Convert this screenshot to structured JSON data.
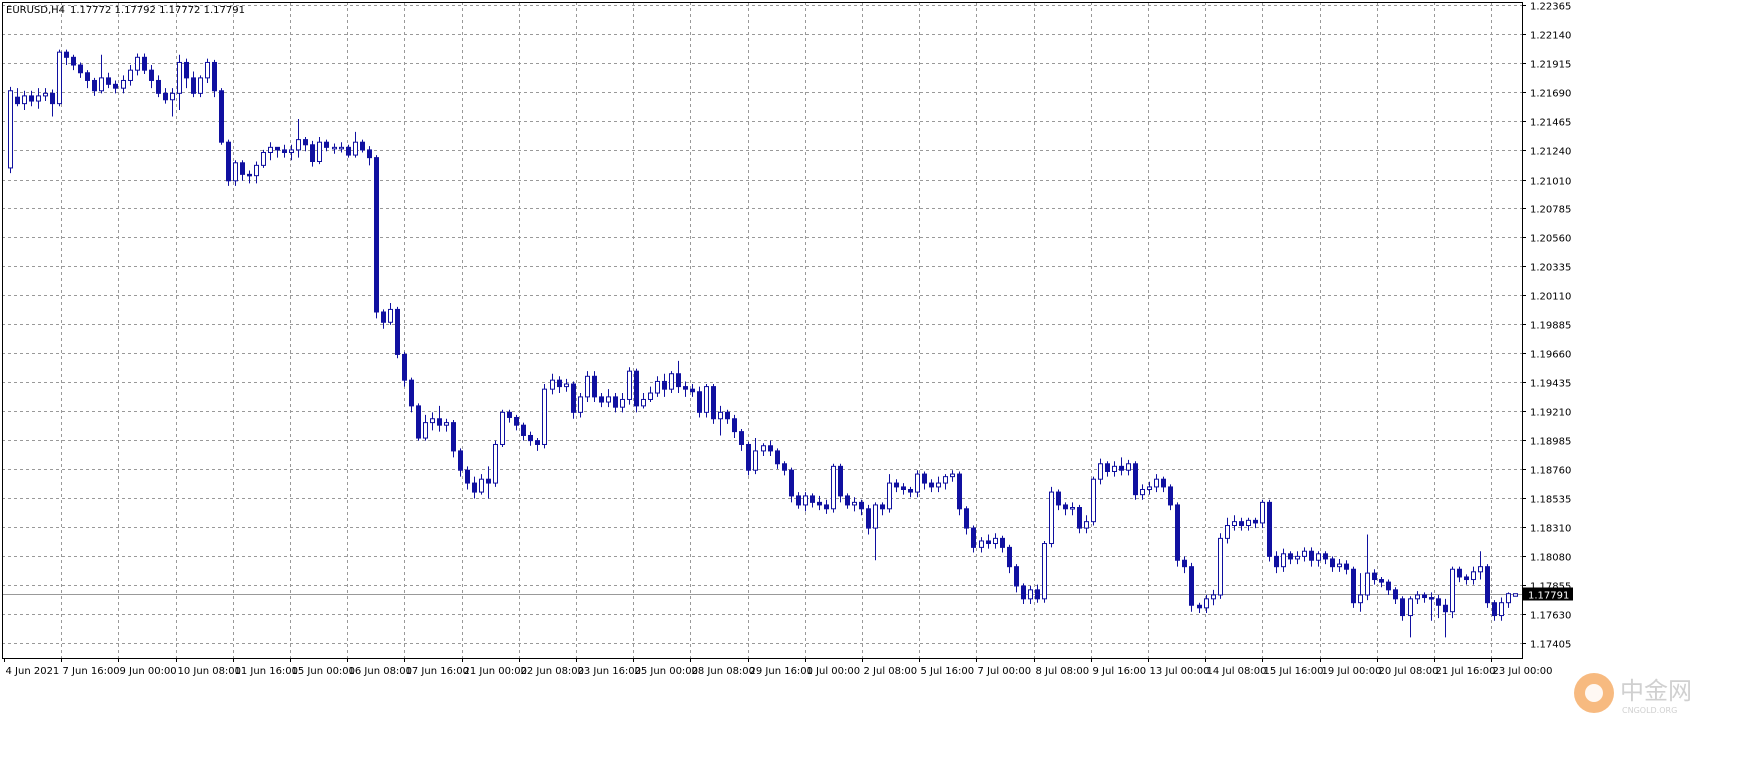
{
  "header": {
    "symbol_text": "EURUSD,H4",
    "ohlc_text": "1.17772 1.17792 1.17772 1.17791"
  },
  "price_label": "1.17791",
  "watermark": {
    "text": "中金网",
    "sub": "CNGOLD.ORG"
  },
  "colors": {
    "candle": "#1010a0",
    "grid": "#999999",
    "axis": "#000000",
    "last_price_line": "#999999"
  },
  "chart_data": {
    "type": "candlestick",
    "symbol": "EURUSD",
    "timeframe": "H4",
    "ylim": [
      1.1729,
      1.2239
    ],
    "y_ticks": [
      "1.22365",
      "1.22140",
      "1.21915",
      "1.21690",
      "1.21465",
      "1.21240",
      "1.21010",
      "1.20785",
      "1.20560",
      "1.20335",
      "1.20110",
      "1.19885",
      "1.19660",
      "1.19435",
      "1.19210",
      "1.18985",
      "1.18760",
      "1.18535",
      "1.18310",
      "1.18080",
      "1.17855",
      "1.17630",
      "1.17405"
    ],
    "x_labels": [
      "4 Jun 2021",
      "7 Jun 16:00",
      "9 Jun 00:00",
      "10 Jun 08:00",
      "11 Jun 16:00",
      "15 Jun 00:00",
      "16 Jun 08:00",
      "17 Jun 16:00",
      "21 Jun 00:00",
      "22 Jun 08:00",
      "23 Jun 16:00",
      "25 Jun 00:00",
      "28 Jun 08:00",
      "29 Jun 16:00",
      "1 Jul 00:00",
      "2 Jul 08:00",
      "5 Jul 16:00",
      "7 Jul 00:00",
      "8 Jul 08:00",
      "9 Jul 16:00",
      "13 Jul 00:00",
      "14 Jul 08:00",
      "15 Jul 16:00",
      "19 Jul 00:00",
      "20 Jul 08:00",
      "21 Jul 16:00",
      "23 Jul 00:00"
    ],
    "last_price": 1.17791,
    "candles": [
      [
        1.211,
        1.217,
        1.2106,
        1.2173
      ],
      [
        1.2165,
        1.216,
        1.2158,
        1.2172
      ],
      [
        1.216,
        1.2166,
        1.2155,
        1.217
      ],
      [
        1.2166,
        1.2162,
        1.2158,
        1.217
      ],
      [
        1.2162,
        1.2166,
        1.2156,
        1.2172
      ],
      [
        1.2166,
        1.2168,
        1.2162,
        1.2172
      ],
      [
        1.2168,
        1.216,
        1.215,
        1.2171
      ],
      [
        1.216,
        1.22,
        1.2158,
        1.2202
      ],
      [
        1.22,
        1.2196,
        1.219,
        1.2202
      ],
      [
        1.2196,
        1.219,
        1.2186,
        1.2198
      ],
      [
        1.219,
        1.2184,
        1.218,
        1.2192
      ],
      [
        1.2184,
        1.2178,
        1.2172,
        1.2186
      ],
      [
        1.2178,
        1.217,
        1.2166,
        1.218
      ],
      [
        1.217,
        1.218,
        1.2168,
        1.2198
      ],
      [
        1.218,
        1.2175,
        1.2172,
        1.2184
      ],
      [
        1.2175,
        1.2172,
        1.2168,
        1.2178
      ],
      [
        1.2172,
        1.2178,
        1.2168,
        1.2182
      ],
      [
        1.2178,
        1.2186,
        1.2174,
        1.219
      ],
      [
        1.2186,
        1.2196,
        1.2182,
        1.2199
      ],
      [
        1.2196,
        1.2186,
        1.2183,
        1.2199
      ],
      [
        1.2186,
        1.2178,
        1.2172,
        1.219
      ],
      [
        1.2178,
        1.2168,
        1.2165,
        1.2182
      ],
      [
        1.2168,
        1.2163,
        1.216,
        1.2172
      ],
      [
        1.2163,
        1.2168,
        1.215,
        1.2172
      ],
      [
        1.2168,
        1.2192,
        1.2155,
        1.2198
      ],
      [
        1.2192,
        1.218,
        1.2172,
        1.2195
      ],
      [
        1.218,
        1.2168,
        1.2165,
        1.2185
      ],
      [
        1.2168,
        1.218,
        1.2165,
        1.2182
      ],
      [
        1.218,
        1.2192,
        1.2176,
        1.2195
      ],
      [
        1.2192,
        1.217,
        1.2165,
        1.2194
      ],
      [
        1.217,
        1.213,
        1.2128,
        1.2172
      ],
      [
        1.213,
        1.21,
        1.2096,
        1.2132
      ],
      [
        1.21,
        1.2114,
        1.2096,
        1.2116
      ],
      [
        1.2114,
        1.2105,
        1.21,
        1.2116
      ],
      [
        1.2105,
        1.2104,
        1.2098,
        1.2108
      ],
      [
        1.2104,
        1.2112,
        1.2098,
        1.2115
      ],
      [
        1.2112,
        1.2122,
        1.211,
        1.2124
      ],
      [
        1.2122,
        1.2126,
        1.2116,
        1.213
      ],
      [
        1.2126,
        1.2124,
        1.2118,
        1.2126
      ],
      [
        1.2124,
        1.2122,
        1.2118,
        1.2128
      ],
      [
        1.2122,
        1.2124,
        1.2116,
        1.2128
      ],
      [
        1.2124,
        1.2132,
        1.2118,
        1.2148
      ],
      [
        1.2132,
        1.2128,
        1.2123,
        1.2134
      ],
      [
        1.2128,
        1.2115,
        1.2111,
        1.2131
      ],
      [
        1.2115,
        1.213,
        1.2113,
        1.2134
      ],
      [
        1.213,
        1.2126,
        1.2123,
        1.2132
      ],
      [
        1.2126,
        1.2126,
        1.2121,
        1.2129
      ],
      [
        1.2126,
        1.2126,
        1.2122,
        1.213
      ],
      [
        1.2126,
        1.212,
        1.2118,
        1.2128
      ],
      [
        1.212,
        1.213,
        1.2118,
        1.2138
      ],
      [
        1.213,
        1.2124,
        1.2122,
        1.2132
      ],
      [
        1.2124,
        1.2118,
        1.2112,
        1.2127
      ],
      [
        1.2118,
        1.1998,
        1.1993,
        1.212
      ],
      [
        1.1998,
        1.199,
        1.1985,
        1.2
      ],
      [
        1.199,
        1.2,
        1.1988,
        1.2005
      ],
      [
        1.2,
        1.1965,
        1.1962,
        1.2002
      ],
      [
        1.1965,
        1.1945,
        1.194,
        1.1967
      ],
      [
        1.1945,
        1.1925,
        1.192,
        1.1947
      ],
      [
        1.1925,
        1.19,
        1.1898,
        1.1927
      ],
      [
        1.19,
        1.1912,
        1.1898,
        1.1918
      ],
      [
        1.1912,
        1.1915,
        1.1906,
        1.192
      ],
      [
        1.1915,
        1.191,
        1.1905,
        1.1925
      ],
      [
        1.191,
        1.1912,
        1.1905,
        1.1915
      ],
      [
        1.1912,
        1.189,
        1.1885,
        1.1914
      ],
      [
        1.189,
        1.1875,
        1.187,
        1.1892
      ],
      [
        1.1875,
        1.1865,
        1.186,
        1.1878
      ],
      [
        1.1865,
        1.1858,
        1.1853,
        1.187
      ],
      [
        1.1858,
        1.1868,
        1.1856,
        1.1872
      ],
      [
        1.1868,
        1.1865,
        1.1853,
        1.1878
      ],
      [
        1.1865,
        1.1895,
        1.1862,
        1.1898
      ],
      [
        1.1895,
        1.192,
        1.1893,
        1.1922
      ],
      [
        1.192,
        1.1916,
        1.1912,
        1.1922
      ],
      [
        1.1916,
        1.191,
        1.1906,
        1.1918
      ],
      [
        1.191,
        1.1902,
        1.1898,
        1.1912
      ],
      [
        1.1902,
        1.1898,
        1.1894,
        1.1905
      ],
      [
        1.1898,
        1.1895,
        1.189,
        1.19
      ],
      [
        1.1895,
        1.1938,
        1.1892,
        1.1942
      ],
      [
        1.1938,
        1.1945,
        1.1934,
        1.195
      ],
      [
        1.1945,
        1.194,
        1.1935,
        1.1948
      ],
      [
        1.194,
        1.1942,
        1.1936,
        1.1946
      ],
      [
        1.1942,
        1.192,
        1.1915,
        1.1944
      ],
      [
        1.192,
        1.1932,
        1.1916,
        1.1935
      ],
      [
        1.1932,
        1.1948,
        1.1928,
        1.1952
      ],
      [
        1.1948,
        1.1932,
        1.1928,
        1.1952
      ],
      [
        1.1932,
        1.1928,
        1.1924,
        1.1935
      ],
      [
        1.1928,
        1.1932,
        1.1924,
        1.1938
      ],
      [
        1.1932,
        1.1924,
        1.192,
        1.1935
      ],
      [
        1.1924,
        1.193,
        1.192,
        1.1935
      ],
      [
        1.193,
        1.1952,
        1.1926,
        1.1955
      ],
      [
        1.1952,
        1.1925,
        1.192,
        1.1954
      ],
      [
        1.1925,
        1.193,
        1.1923,
        1.1935
      ],
      [
        1.193,
        1.1935,
        1.1928,
        1.194
      ],
      [
        1.1935,
        1.1944,
        1.1932,
        1.1948
      ],
      [
        1.1944,
        1.1938,
        1.1932,
        1.195
      ],
      [
        1.1938,
        1.195,
        1.1935,
        1.1952
      ],
      [
        1.195,
        1.194,
        1.1935,
        1.196
      ],
      [
        1.194,
        1.1938,
        1.1932,
        1.1944
      ],
      [
        1.1938,
        1.1936,
        1.1932,
        1.1942
      ],
      [
        1.1936,
        1.192,
        1.1916,
        1.194
      ],
      [
        1.192,
        1.194,
        1.1916,
        1.1942
      ],
      [
        1.194,
        1.1915,
        1.1911,
        1.1942
      ],
      [
        1.1915,
        1.192,
        1.1902,
        1.1925
      ],
      [
        1.192,
        1.1915,
        1.1911,
        1.1922
      ],
      [
        1.1915,
        1.1905,
        1.19,
        1.1918
      ],
      [
        1.1905,
        1.1895,
        1.189,
        1.1907
      ],
      [
        1.1895,
        1.1875,
        1.1871,
        1.1897
      ],
      [
        1.1875,
        1.189,
        1.1872,
        1.19
      ],
      [
        1.189,
        1.1894,
        1.1886,
        1.1896
      ],
      [
        1.1894,
        1.189,
        1.1886,
        1.1898
      ],
      [
        1.189,
        1.188,
        1.1876,
        1.1892
      ],
      [
        1.188,
        1.1875,
        1.1871,
        1.1882
      ],
      [
        1.1875,
        1.1855,
        1.185,
        1.1877
      ],
      [
        1.1855,
        1.1848,
        1.1845,
        1.1858
      ],
      [
        1.1848,
        1.1855,
        1.1843,
        1.1858
      ],
      [
        1.1855,
        1.185,
        1.1846,
        1.1857
      ],
      [
        1.185,
        1.1848,
        1.1844,
        1.1855
      ],
      [
        1.1848,
        1.1845,
        1.1841,
        1.1852
      ],
      [
        1.1845,
        1.1878,
        1.1842,
        1.188
      ],
      [
        1.1878,
        1.1855,
        1.185,
        1.188
      ],
      [
        1.1855,
        1.1848,
        1.1845,
        1.1857
      ],
      [
        1.1848,
        1.185,
        1.1843,
        1.1854
      ],
      [
        1.185,
        1.1845,
        1.184,
        1.1852
      ],
      [
        1.1845,
        1.183,
        1.1825,
        1.1848
      ],
      [
        1.183,
        1.1848,
        1.1805,
        1.185
      ],
      [
        1.1848,
        1.1845,
        1.184,
        1.185
      ],
      [
        1.1845,
        1.1865,
        1.1842,
        1.1872
      ],
      [
        1.1865,
        1.1862,
        1.1858,
        1.1868
      ],
      [
        1.1862,
        1.186,
        1.1856,
        1.1865
      ],
      [
        1.186,
        1.1858,
        1.1854,
        1.1862
      ],
      [
        1.1858,
        1.1872,
        1.1854,
        1.1875
      ],
      [
        1.1872,
        1.1865,
        1.186,
        1.1874
      ],
      [
        1.1865,
        1.1862,
        1.1858,
        1.1868
      ],
      [
        1.1862,
        1.1865,
        1.1858,
        1.187
      ],
      [
        1.1865,
        1.187,
        1.186,
        1.1872
      ],
      [
        1.187,
        1.1872,
        1.1866,
        1.1875
      ],
      [
        1.1872,
        1.1845,
        1.184,
        1.1874
      ],
      [
        1.1845,
        1.183,
        1.1825,
        1.1847
      ],
      [
        1.183,
        1.1815,
        1.1811,
        1.1832
      ],
      [
        1.1815,
        1.182,
        1.1811,
        1.1823
      ],
      [
        1.182,
        1.1818,
        1.1814,
        1.1825
      ],
      [
        1.1818,
        1.1822,
        1.1814,
        1.1826
      ],
      [
        1.1822,
        1.1815,
        1.1811,
        1.1824
      ],
      [
        1.1815,
        1.18,
        1.1795,
        1.1817
      ],
      [
        1.18,
        1.1785,
        1.178,
        1.1802
      ],
      [
        1.1785,
        1.1775,
        1.1771,
        1.1787
      ],
      [
        1.1775,
        1.1782,
        1.1771,
        1.1785
      ],
      [
        1.1782,
        1.1775,
        1.1772,
        1.1786
      ],
      [
        1.1775,
        1.1818,
        1.1772,
        1.182
      ],
      [
        1.1818,
        1.1858,
        1.1815,
        1.1862
      ],
      [
        1.1858,
        1.1848,
        1.1844,
        1.186
      ],
      [
        1.1848,
        1.1845,
        1.184,
        1.185
      ],
      [
        1.1845,
        1.1846,
        1.184,
        1.185
      ],
      [
        1.1846,
        1.183,
        1.1826,
        1.1848
      ],
      [
        1.183,
        1.1835,
        1.1826,
        1.184
      ],
      [
        1.1835,
        1.1868,
        1.1832,
        1.187
      ],
      [
        1.1868,
        1.188,
        1.1864,
        1.1884
      ],
      [
        1.188,
        1.1874,
        1.187,
        1.1882
      ],
      [
        1.1874,
        1.1878,
        1.187,
        1.1882
      ],
      [
        1.1878,
        1.1875,
        1.1871,
        1.1885
      ],
      [
        1.1875,
        1.188,
        1.1871,
        1.1883
      ],
      [
        1.188,
        1.1856,
        1.1852,
        1.1882
      ],
      [
        1.1856,
        1.186,
        1.1852,
        1.1864
      ],
      [
        1.186,
        1.1862,
        1.1856,
        1.1866
      ],
      [
        1.1862,
        1.1868,
        1.1858,
        1.1872
      ],
      [
        1.1868,
        1.1862,
        1.1858,
        1.187
      ],
      [
        1.1862,
        1.1848,
        1.1844,
        1.1864
      ],
      [
        1.1848,
        1.1805,
        1.18,
        1.185
      ],
      [
        1.1805,
        1.18,
        1.1795,
        1.1808
      ],
      [
        1.18,
        1.177,
        1.1765,
        1.1803
      ],
      [
        1.177,
        1.1768,
        1.1764,
        1.1772
      ],
      [
        1.1768,
        1.1775,
        1.1764,
        1.1778
      ],
      [
        1.1775,
        1.1778,
        1.177,
        1.1782
      ],
      [
        1.1778,
        1.1822,
        1.1775,
        1.1826
      ],
      [
        1.1822,
        1.1832,
        1.1818,
        1.1838
      ],
      [
        1.1832,
        1.1835,
        1.1828,
        1.184
      ],
      [
        1.1835,
        1.1832,
        1.1828,
        1.1838
      ],
      [
        1.1832,
        1.1836,
        1.1828,
        1.1838
      ],
      [
        1.1836,
        1.1834,
        1.183,
        1.1838
      ],
      [
        1.1834,
        1.185,
        1.183,
        1.1852
      ],
      [
        1.185,
        1.1808,
        1.1804,
        1.1852
      ],
      [
        1.1808,
        1.18,
        1.1795,
        1.1812
      ],
      [
        1.18,
        1.181,
        1.1796,
        1.1814
      ],
      [
        1.181,
        1.1806,
        1.1802,
        1.1812
      ],
      [
        1.1806,
        1.1808,
        1.1802,
        1.1812
      ],
      [
        1.1808,
        1.1812,
        1.1804,
        1.1815
      ],
      [
        1.1812,
        1.1805,
        1.18,
        1.1815
      ],
      [
        1.1805,
        1.181,
        1.18,
        1.1812
      ],
      [
        1.181,
        1.1806,
        1.1802,
        1.1812
      ],
      [
        1.1806,
        1.18,
        1.1796,
        1.1808
      ],
      [
        1.18,
        1.1802,
        1.1796,
        1.1806
      ],
      [
        1.1802,
        1.1798,
        1.1794,
        1.1805
      ],
      [
        1.1798,
        1.1772,
        1.1768,
        1.18
      ],
      [
        1.1772,
        1.1778,
        1.1765,
        1.1795
      ],
      [
        1.1778,
        1.1795,
        1.1774,
        1.1825
      ],
      [
        1.1795,
        1.179,
        1.1786,
        1.1798
      ],
      [
        1.179,
        1.1788,
        1.1784,
        1.1792
      ],
      [
        1.1788,
        1.1782,
        1.1778,
        1.179
      ],
      [
        1.1782,
        1.1775,
        1.1771,
        1.1784
      ],
      [
        1.1775,
        1.1762,
        1.1758,
        1.1777
      ],
      [
        1.1762,
        1.1775,
        1.1745,
        1.1777
      ],
      [
        1.1775,
        1.1778,
        1.1771,
        1.1781
      ],
      [
        1.1778,
        1.1776,
        1.1772,
        1.178
      ],
      [
        1.1776,
        1.1775,
        1.1758,
        1.178
      ],
      [
        1.1775,
        1.177,
        1.176,
        1.1778
      ],
      [
        1.177,
        1.1765,
        1.1745,
        1.1775
      ],
      [
        1.1765,
        1.1798,
        1.176,
        1.18
      ],
      [
        1.1798,
        1.1792,
        1.1788,
        1.18
      ],
      [
        1.1792,
        1.179,
        1.1786,
        1.1794
      ],
      [
        1.179,
        1.1796,
        1.1786,
        1.18
      ],
      [
        1.1796,
        1.18,
        1.179,
        1.1812
      ],
      [
        1.18,
        1.1772,
        1.1768,
        1.1802
      ],
      [
        1.1772,
        1.1762,
        1.1758,
        1.1774
      ],
      [
        1.1762,
        1.1772,
        1.1758,
        1.1776
      ],
      [
        1.1772,
        1.1779,
        1.1768,
        1.178
      ],
      [
        1.1777,
        1.1779,
        1.1777,
        1.1779
      ]
    ]
  }
}
